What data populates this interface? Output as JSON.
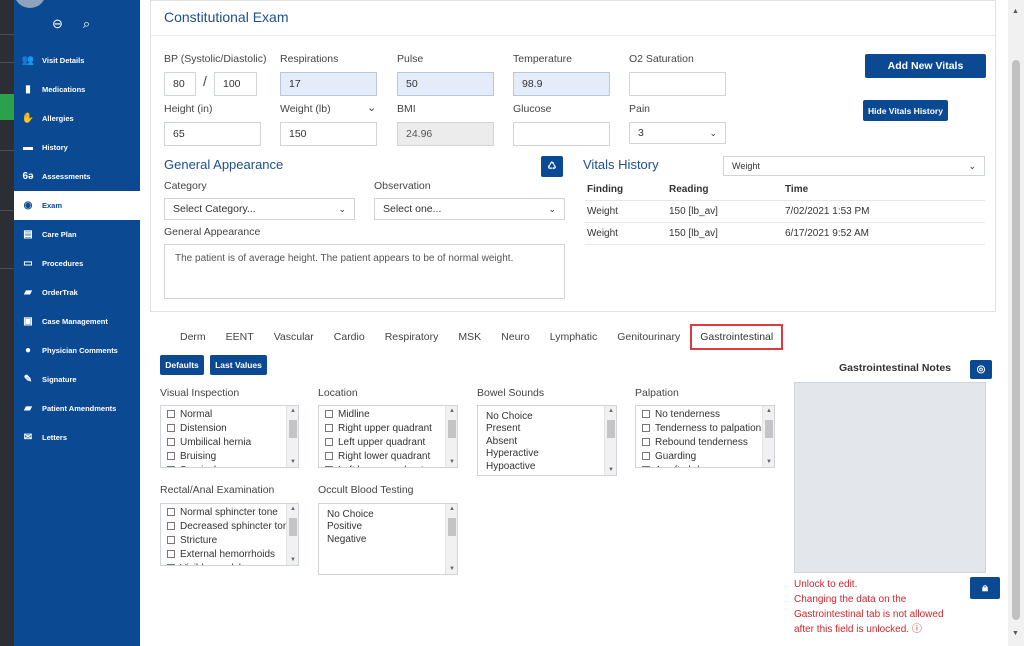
{
  "sidebar": {
    "items": [
      {
        "label": "Visit Details",
        "icon": "group-icon",
        "glyph": "👥"
      },
      {
        "label": "Medications",
        "icon": "medication-icon",
        "glyph": "▮"
      },
      {
        "label": "Allergies",
        "icon": "hand-icon",
        "glyph": "✋"
      },
      {
        "label": "History",
        "icon": "book-icon",
        "glyph": "▬"
      },
      {
        "label": "Assessments",
        "icon": "glasses-icon",
        "glyph": "6ə"
      },
      {
        "label": "Exam",
        "icon": "eye-icon",
        "glyph": "◉"
      },
      {
        "label": "Care Plan",
        "icon": "document-icon",
        "glyph": "▤"
      },
      {
        "label": "Procedures",
        "icon": "bed-icon",
        "glyph": "▭"
      },
      {
        "label": "OrderTrak",
        "icon": "truck-icon",
        "glyph": "▰"
      },
      {
        "label": "Case Management",
        "icon": "clipboard-icon",
        "glyph": "▣"
      },
      {
        "label": "Physician Comments",
        "icon": "person-icon",
        "glyph": "●"
      },
      {
        "label": "Signature",
        "icon": "signature-icon",
        "glyph": "✎"
      },
      {
        "label": "Patient Amendments",
        "icon": "folder-icon",
        "glyph": "▰"
      },
      {
        "label": "Letters",
        "icon": "envelope-icon",
        "glyph": "✉"
      }
    ],
    "active_index": 5
  },
  "exam": {
    "title": "Constitutional Exam",
    "vitals": {
      "bp_label": "BP (Systolic/Diastolic)",
      "systolic": "80",
      "bp_sep": "/",
      "diastolic": "100",
      "resp_label": "Respirations",
      "resp": "17",
      "pulse_label": "Pulse",
      "pulse": "50",
      "temp_label": "Temperature",
      "temp": "98.9",
      "o2_label": "O2 Saturation",
      "o2": "",
      "height_label": "Height (in)",
      "height": "65",
      "weight_label": "Weight (lb)",
      "weight": "150",
      "bmi_label": "BMI",
      "bmi": "24.96",
      "glucose_label": "Glucose",
      "glucose": "",
      "pain_label": "Pain",
      "pain": "3"
    },
    "add_vitals_label": "Add New Vitals",
    "hide_vitals_label": "Hide Vitals History",
    "general_appearance": {
      "title": "General Appearance",
      "category_label": "Category",
      "category_value": "Select Category...",
      "observation_label": "Observation",
      "observation_value": "Select one...",
      "text_label": "General Appearance",
      "text": "The patient is of average height. The patient appears to be of normal weight."
    },
    "vitals_history": {
      "title": "Vitals History",
      "filter": "Weight",
      "headers": [
        "Finding",
        "Reading",
        "Time"
      ],
      "rows": [
        [
          "Weight",
          "150 [lb_av]",
          "7/02/2021 1:53 PM"
        ],
        [
          "Weight",
          "150 [lb_av]",
          "6/17/2021 9:52 AM"
        ]
      ]
    }
  },
  "tabs": [
    "Derm",
    "EENT",
    "Vascular",
    "Cardio",
    "Respiratory",
    "MSK",
    "Neuro",
    "Lymphatic",
    "Genitourinary",
    "Gastrointestinal"
  ],
  "active_tab_index": 9,
  "gi": {
    "defaults_label": "Defaults",
    "last_values_label": "Last Values",
    "visual_inspection": {
      "label": "Visual Inspection",
      "options": [
        "Normal",
        "Distension",
        "Umbilical hernia",
        "Bruising",
        "Surgical scar or scars"
      ]
    },
    "location": {
      "label": "Location",
      "options": [
        "Midline",
        "Right upper quadrant",
        "Left upper quadrant",
        "Right lower quadrant",
        "Left lower quadrant"
      ]
    },
    "bowel_sounds": {
      "label": "Bowel Sounds",
      "options": [
        "No Choice",
        "Present",
        "Absent",
        "Hyperactive",
        "Hypoactive"
      ]
    },
    "palpation": {
      "label": "Palpation",
      "options": [
        "No tenderness",
        "Tenderness to palpation",
        "Rebound tenderness",
        "Guarding",
        "A soft abdomen"
      ]
    },
    "rectal": {
      "label": "Rectal/Anal Examination",
      "options": [
        "Normal sphincter tone",
        "Decreased sphincter tone",
        "Stricture",
        "External hemorrhoids",
        "Visible condyloma"
      ]
    },
    "occult": {
      "label": "Occult Blood Testing",
      "options": [
        "No Choice",
        "Positive",
        "Negative"
      ]
    },
    "notes_title": "Gastrointestinal Notes",
    "warning_lines": [
      "Unlock to edit.",
      "Changing the data on the",
      "Gastrointestinal tab is not allowed",
      "after this field is unlocked. ⓘ"
    ]
  }
}
